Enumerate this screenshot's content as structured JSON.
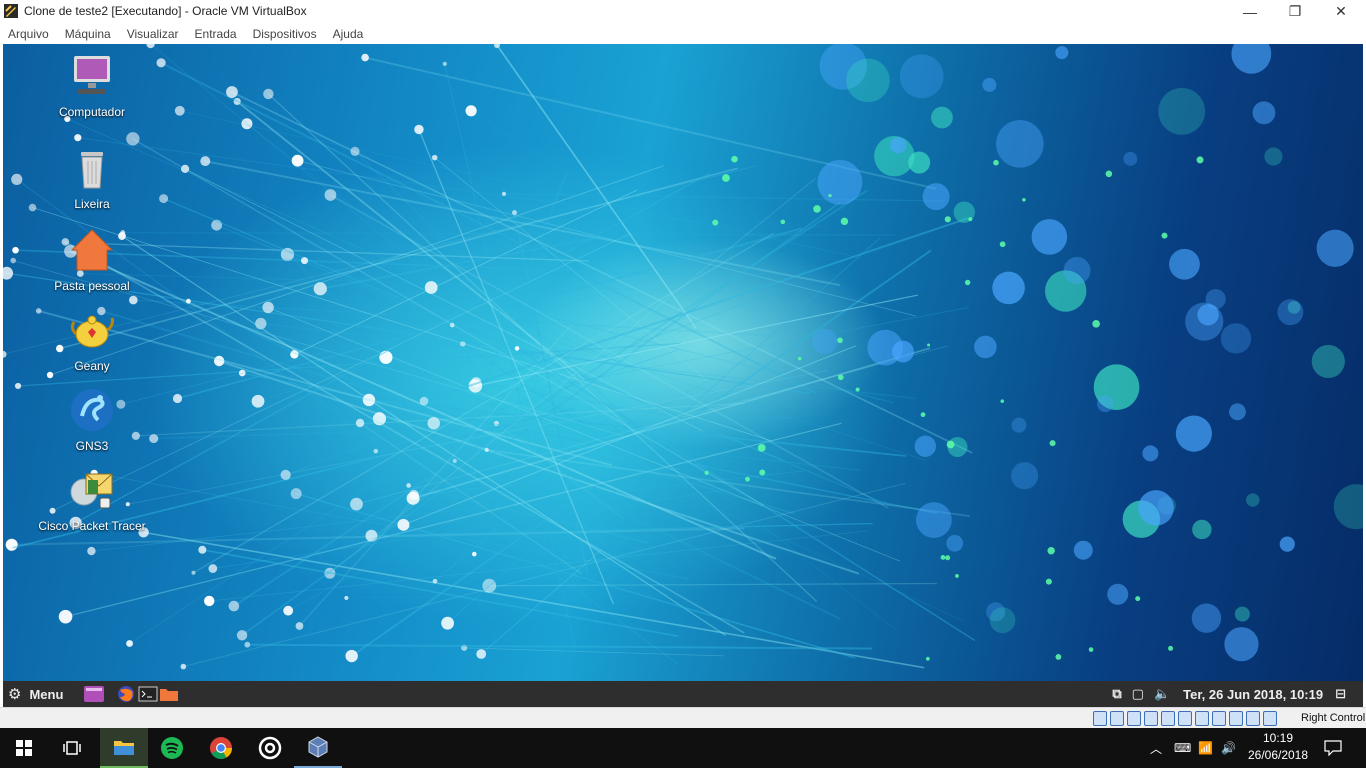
{
  "window": {
    "title": "Clone de teste2 [Executando] - Oracle VM VirtualBox",
    "controls": {
      "minimize": "—",
      "restore": "❐",
      "close": "✕"
    }
  },
  "menubar": [
    "Arquivo",
    "Máquina",
    "Visualizar",
    "Entrada",
    "Dispositivos",
    "Ajuda"
  ],
  "desktop": {
    "icons": [
      {
        "label": "Computador",
        "icon": "computer-icon"
      },
      {
        "label": "Lixeira",
        "icon": "trash-icon"
      },
      {
        "label": "Pasta pessoal",
        "icon": "home-folder-icon"
      },
      {
        "label": "Geany",
        "icon": "geany-icon"
      },
      {
        "label": "GNS3",
        "icon": "gns3-icon"
      },
      {
        "label": "Cisco Packet Tracer",
        "icon": "packet-tracer-icon"
      }
    ]
  },
  "guest_panel": {
    "menu_label": "Menu",
    "launchers": [
      "show-desktop-icon",
      "firefox-icon",
      "terminal-icon",
      "file-manager-icon"
    ],
    "tray_icons": [
      "network-icon",
      "workspace-icon",
      "volume-icon"
    ],
    "clock": "Ter, 26 Jun 2018, 10:19",
    "end_icon": "display-icon"
  },
  "vbox_status": {
    "host_key": "Right Control"
  },
  "taskbar": {
    "apps": [
      "start-icon",
      "task-view-icon",
      "file-explorer-icon",
      "spotify-icon",
      "chrome-icon",
      "groove-icon",
      "virtualbox-icon"
    ],
    "time": "10:19",
    "date": "26/06/2018"
  },
  "colors": {
    "guest_panel": "#2e2e2e",
    "taskbar": "#101010"
  }
}
